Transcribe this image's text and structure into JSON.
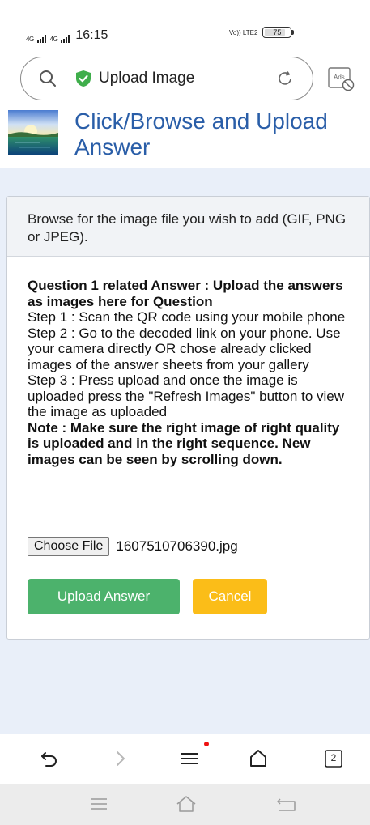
{
  "status_bar": {
    "signal_1": "4G",
    "signal_2": "4G",
    "time": "16:15",
    "volte": "Vo)) LTE2",
    "battery": "75"
  },
  "browser": {
    "address_text": "Upload Image",
    "icons": [
      "search-icon",
      "shield-check-icon",
      "reload-icon",
      "ads-block-icon"
    ]
  },
  "page": {
    "title": "Click/Browse and Upload Answer"
  },
  "dialog": {
    "intro": "Browse for the image file you wish to add (GIF, PNG or JPEG).",
    "question_heading": "Question 1 related Answer : Upload the answers as images here for Question",
    "step1": "Step 1 : Scan the QR code using your mobile phone",
    "step2": "Step 2 : Go to the decoded link on your phone. Use your camera directly OR chose already clicked images of the answer sheets from your gallery",
    "step3": "Step 3 : Press upload and once the image is uploaded press the \"Refresh Images\" button to view the image as uploaded",
    "note": "Note : Make sure the right image of right quality is uploaded and in the right sequence. New images can be seen by scrolling down.",
    "choose_file_label": "Choose File",
    "file_name": "1607510706390.jpg",
    "upload_button": "Upload Answer",
    "cancel_button": "Cancel"
  },
  "toolbar": {
    "tabs_count": "2",
    "icons": [
      "back-icon",
      "forward-icon",
      "menu-icon",
      "home-icon",
      "tabs-icon"
    ]
  },
  "colors": {
    "title_blue": "#2a5ea8",
    "upload_green": "#4cb26c",
    "cancel_yellow": "#fbbd18",
    "page_bg": "#e9eff9"
  }
}
